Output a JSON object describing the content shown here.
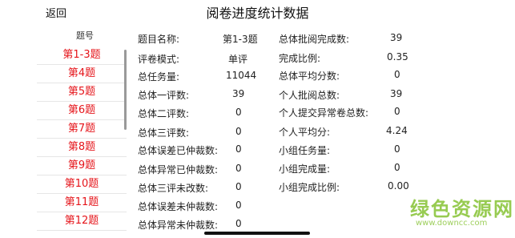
{
  "header": {
    "back_label": "返回",
    "title": "阅卷进度统计数据"
  },
  "sidebar": {
    "header": "题号",
    "items": [
      "第1-3题",
      "第4题",
      "第5题",
      "第6题",
      "第7题",
      "第8题",
      "第9题",
      "第10题",
      "第11题",
      "第12题"
    ]
  },
  "stats_left": [
    {
      "label": "题目名称:",
      "value": "第1-3题"
    },
    {
      "label": "评卷模式:",
      "value": "单评"
    },
    {
      "label": "总任务量:",
      "value": "11044"
    },
    {
      "label": "总体一评数:",
      "value": "39"
    },
    {
      "label": "总体二评数:",
      "value": "0"
    },
    {
      "label": "总体三评数:",
      "value": "0"
    },
    {
      "label": "总体误差已仲裁数:",
      "value": "0"
    },
    {
      "label": "总体异常已仲裁数:",
      "value": "0"
    },
    {
      "label": "总体三评未改数:",
      "value": "0"
    },
    {
      "label": "总体误差未仲裁数:",
      "value": "0"
    },
    {
      "label": "总体异常未仲裁数:",
      "value": "0"
    }
  ],
  "stats_right": [
    {
      "label": "总体批阅完成数:",
      "value": "39"
    },
    {
      "label": "完成比例:",
      "value": "0.35"
    },
    {
      "label": "总体平均分数:",
      "value": "0"
    },
    {
      "label": "个人批阅总数:",
      "value": "39"
    },
    {
      "label": "个人提交异常卷总数:",
      "value": "0"
    },
    {
      "label": "个人平均分:",
      "value": "4.24"
    },
    {
      "label": "小组任务量:",
      "value": "0"
    },
    {
      "label": "小组完成量:",
      "value": "0"
    },
    {
      "label": "小组完成比例:",
      "value": "0.00"
    }
  ],
  "watermark": {
    "brand": "绿色资源网",
    "url": "www.downcc.com",
    "color": "#8cc63f"
  }
}
